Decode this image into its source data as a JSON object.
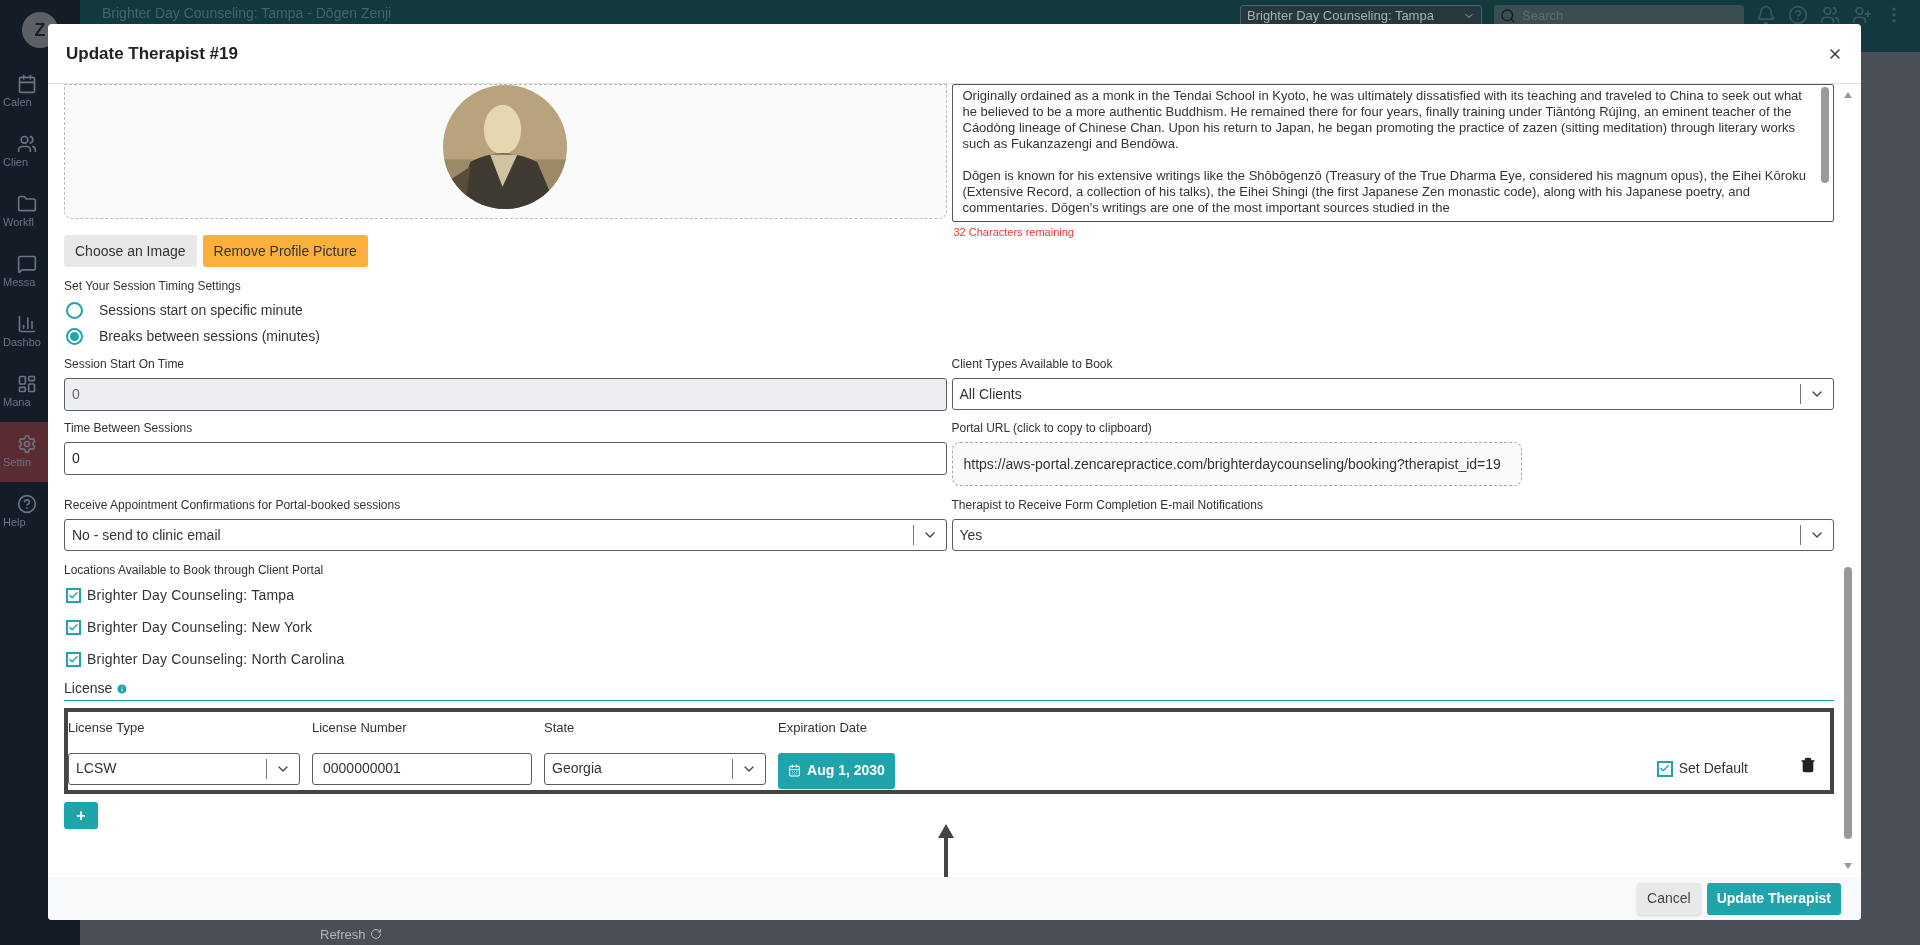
{
  "app": {
    "avatar": "Z",
    "nav": [
      {
        "label": "Calen",
        "kind": "calendar",
        "selected": false
      },
      {
        "label": "Clien",
        "kind": "users",
        "selected": false
      },
      {
        "label": "Workfl",
        "kind": "folder",
        "selected": false
      },
      {
        "label": "Messa",
        "kind": "message",
        "selected": false
      },
      {
        "label": "Dashbo",
        "kind": "chart",
        "selected": false
      },
      {
        "label": "Mana",
        "kind": "layout",
        "selected": false
      },
      {
        "label": "Settin",
        "kind": "settings",
        "selected": true
      },
      {
        "label": "Help",
        "kind": "help",
        "selected": false
      }
    ],
    "header_title": "Brighter Day Counseling: Tampa - Dōgen Zenji",
    "location_select": "Brighter Day Counseling: Tampa",
    "search": {
      "placeholder": "Search"
    },
    "refresh": "Refresh"
  },
  "dialog": {
    "title": "Update Therapist #19",
    "bio": {
      "paragraphs": [
        "Originally ordained as a monk in the Tendai School in Kyoto, he was ultimately dissatisfied with its teaching and traveled to China to seek out what he believed to be a more authentic Buddhism. He remained there for four years, finally training under Tiāntóng Rújìng, an eminent teacher of the Cáodòng lineage of Chinese Chan. Upon his return to Japan, he began promoting the practice of zazen (sitting meditation) through literary works such as Fukanzazengi and Bendōwa.",
        "Dōgen is known for his extensive writings like the Shōbōgenzō (Treasury of the True Dharma Eye, considered his magnum opus), the Eihei Kōroku (Extensive Record, a collection of his talks), the Eihei Shingi (the first Japanese Zen monastic code), along with his Japanese poetry, and commentaries. Dōgen's writings are one of the most important sources studied in the"
      ],
      "counter": "32 Characters remaining"
    },
    "image_buttons": [
      {
        "label": "Choose an Image",
        "kind": "secondary"
      },
      {
        "label": "Remove Profile Picture",
        "kind": "warning"
      }
    ],
    "timing": {
      "label": "Set Your Session Timing Settings",
      "options": [
        {
          "label": "Sessions start on specific minute",
          "selected": false
        },
        {
          "label": "Breaks between sessions (minutes)",
          "selected": true
        }
      ]
    },
    "field_rows": [
      [
        {
          "label": "Session Start On Time",
          "kind": "input",
          "value": "0",
          "disabled": true
        },
        {
          "label": "Client Types Available to Book",
          "kind": "select",
          "value": "All Clients"
        }
      ],
      [
        {
          "label": "Time Between Sessions",
          "kind": "input",
          "value": "0",
          "disabled": false
        },
        {
          "label": "Portal URL (click to copy to clipboard)",
          "kind": "link",
          "value": "https://aws-portal.zencarepractice.com/brighterdaycounseling/booking?therapist_id=19"
        }
      ],
      [
        {
          "label": "Receive Appointment Confirmations for Portal-booked sessions",
          "kind": "select",
          "value": "No - send to clinic email"
        },
        {
          "label": "Therapist to Receive Form Completion E-mail Notifications",
          "kind": "select",
          "value": "Yes"
        }
      ]
    ],
    "locations": {
      "label": "Locations Available to Book through Client Portal",
      "items": [
        {
          "label": "Brighter Day Counseling: Tampa",
          "checked": true
        },
        {
          "label": "Brighter Day Counseling: New York",
          "checked": true
        },
        {
          "label": "Brighter Day Counseling: North Carolina",
          "checked": true
        }
      ]
    },
    "license": {
      "label": "License",
      "columns": [
        "License Type",
        "License Number",
        "State",
        "Expiration Date"
      ],
      "rows": [
        {
          "type": "LCSW",
          "number": "0000000001",
          "state": "Georgia",
          "expiration": "Aug 1, 2030",
          "default_label": "Set Default",
          "is_default": true
        }
      ]
    },
    "add_button": "+",
    "footer": [
      {
        "label": "Cancel",
        "kind": "secondary"
      },
      {
        "label": "Update Therapist",
        "kind": "primary"
      }
    ]
  }
}
